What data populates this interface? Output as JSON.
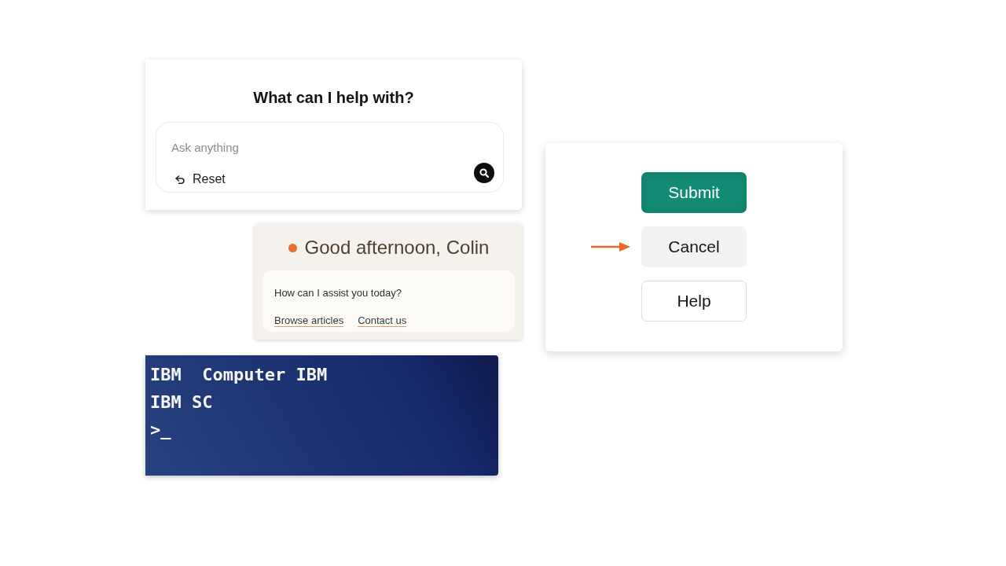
{
  "search_card": {
    "title": "What can I help with?",
    "search": {
      "placeholder": "Ask anything"
    },
    "reset_button": "Reset"
  },
  "greeting_card": {
    "greeting": "Good afternoon, Colin",
    "prompt": "How can I assist you today?",
    "links": [
      "Browse articles",
      "Contact us"
    ]
  },
  "terminal": {
    "lines": [
      "IBM  Computer IBM",
      "IBM SC"
    ],
    "prompt": ">_"
  },
  "dialog": {
    "buttons": [
      {
        "label": "Submit",
        "kind": "primary",
        "pointed": false
      },
      {
        "label": "Cancel",
        "kind": "secondary",
        "pointed": true
      },
      {
        "label": "Help",
        "kind": "outline",
        "pointed": false
      }
    ]
  }
}
